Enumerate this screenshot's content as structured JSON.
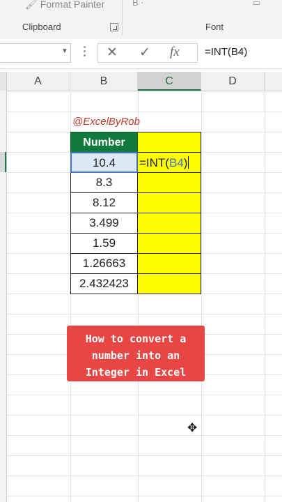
{
  "ribbon": {
    "format_painter_label": "Format Painter",
    "brush_glyph": "🖌",
    "clipboard_label": "Clipboard",
    "font_label": "Font",
    "font_top_icons": "B   ·"
  },
  "formula_bar": {
    "cancel_glyph": "✕",
    "enter_glyph": "✓",
    "fx_glyph": "fx",
    "formula": "=INT(B4)"
  },
  "columns": [
    "A",
    "B",
    "C",
    "D"
  ],
  "selected_column": "C",
  "sheet": {
    "watermark": "@ExcelByRob",
    "header": "Number",
    "values": [
      "10.4",
      "8.3",
      "8.12",
      "3.499",
      "1.59",
      "1.26663",
      "2.432423"
    ],
    "edit_cell": {
      "prefix": "=INT(",
      "ref": "B4",
      "suffix": ")"
    }
  },
  "callout": {
    "text": "How to convert a\nnumber into an\nInteger in Excel",
    "color": "#e84545"
  },
  "colors": {
    "header_green": "#0f7a3c",
    "highlight_yellow": "#ffff00",
    "selection_blue": "#3d72c4"
  },
  "icons": {
    "namebox_dropdown": "chevron-down-icon",
    "cursor": "move-cursor-icon"
  }
}
